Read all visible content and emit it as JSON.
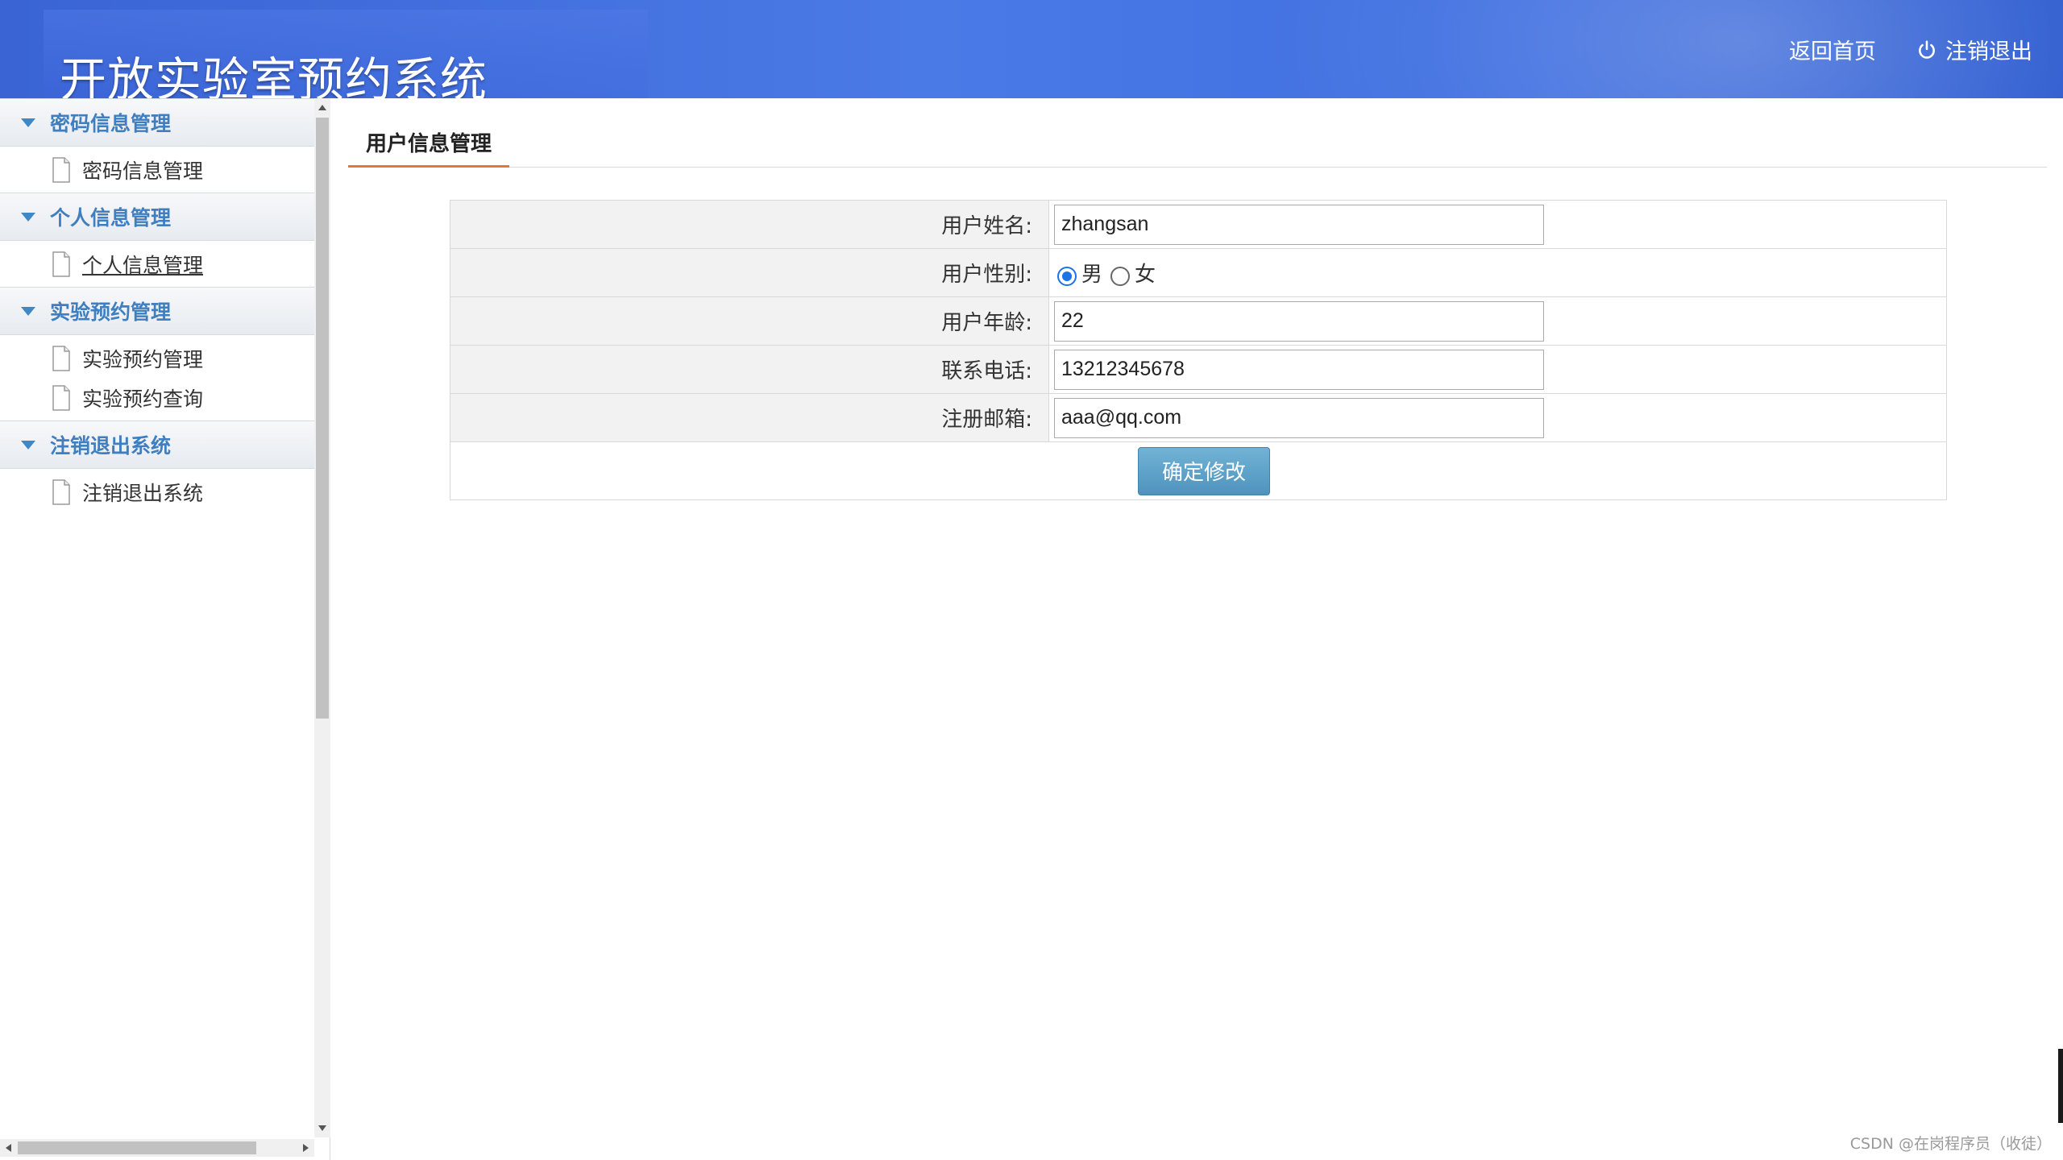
{
  "header": {
    "app_title": "开放实验室预约系统",
    "links": [
      {
        "label": "返回首页",
        "icon": null
      },
      {
        "label": "注销退出",
        "icon": "power-icon"
      }
    ]
  },
  "sidebar": {
    "groups": [
      {
        "title": "密码信息管理",
        "items": [
          {
            "label": "密码信息管理"
          }
        ]
      },
      {
        "title": "个人信息管理",
        "items": [
          {
            "label": "个人信息管理",
            "active": true
          }
        ]
      },
      {
        "title": "实验预约管理",
        "items": [
          {
            "label": "实验预约管理"
          },
          {
            "label": "实验预约查询"
          }
        ]
      },
      {
        "title": "注销退出系统",
        "items": [
          {
            "label": "注销退出系统"
          }
        ]
      }
    ]
  },
  "main": {
    "tab_label": "用户信息管理",
    "form": {
      "name_label": "用户姓名:",
      "name_value": "zhangsan",
      "gender_label": "用户性别:",
      "gender_options": [
        "男",
        "女"
      ],
      "gender_selected": "男",
      "age_label": "用户年龄:",
      "age_value": "22",
      "phone_label": "联系电话:",
      "phone_value": "13212345678",
      "email_label": "注册邮箱:",
      "email_value": "aaa@qq.com",
      "submit_label": "确定修改"
    }
  },
  "watermark": "CSDN @在岗程序员（收徒）",
  "colors": {
    "header_blue": "#3f6fe0",
    "sidebar_group_text": "#3f7fc0",
    "tab_underline": "#e07a3a",
    "button_blue": "#5a9fc8"
  }
}
